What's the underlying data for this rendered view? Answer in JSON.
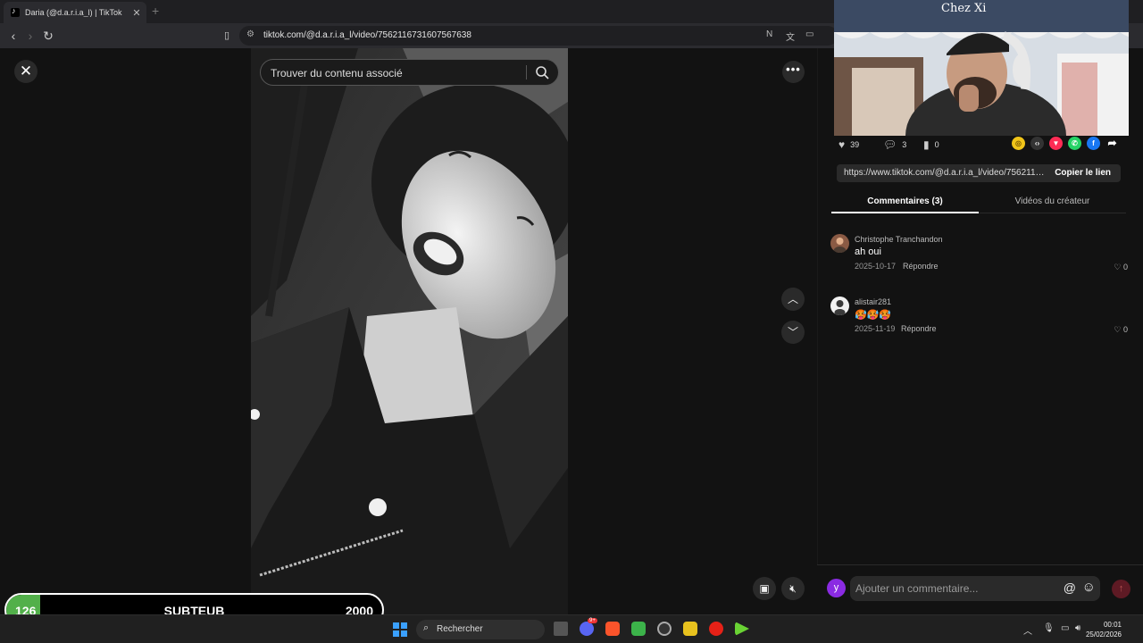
{
  "browser": {
    "tab_title": "Daria (@d.a.r.i.a_l) | TikTok",
    "url": "tiktok.com/@d.a.r.i.a_l/video/7562116731607567638",
    "new_tab_label": "+"
  },
  "video_view": {
    "search_placeholder": "Trouver du contenu associé",
    "more_label": "•••"
  },
  "webcam_sign": "Chez Xi",
  "stats": {
    "likes": "39",
    "comments": "3",
    "saves": "0"
  },
  "share_icons": [
    {
      "name": "coin-icon",
      "color": "#f0c419"
    },
    {
      "name": "embed-icon",
      "color": "#333333"
    },
    {
      "name": "send-icon",
      "color": "#fe2c55"
    },
    {
      "name": "whatsapp-icon",
      "color": "#25d366"
    },
    {
      "name": "facebook-icon",
      "color": "#1877f2"
    }
  ],
  "link": {
    "text": "https://www.tiktok.com/@d.a.r.i.a_l/video/7562116731607567638",
    "copy_label": "Copier le lien"
  },
  "tabs": {
    "comments": "Commentaires (3)",
    "creator_videos": "Vidéos du créateur"
  },
  "comments": [
    {
      "user": "Christophe Tranchandon",
      "text": "ah oui",
      "date": "2025-10-17",
      "reply": "Répondre",
      "likes": "0"
    },
    {
      "user": "alistair281",
      "text": "🥵🥵🥵",
      "date": "2025-11-19",
      "reply": "Répondre",
      "likes": "0"
    }
  ],
  "composer": {
    "avatar_letter": "y",
    "placeholder": "Ajouter un commentaire...",
    "at_label": "@"
  },
  "sub_goal": {
    "current": "126",
    "name": "SUBTEUB",
    "goal": "2000",
    "progress": 0.063
  },
  "taskbar": {
    "search_label": "Rechercher",
    "discord_badge": "9+",
    "time": "00:01",
    "date": "25/02/2026"
  },
  "colors": {
    "accent": "#fe2c55",
    "progress": "#52b04a",
    "windows": "#3aa0ff"
  }
}
